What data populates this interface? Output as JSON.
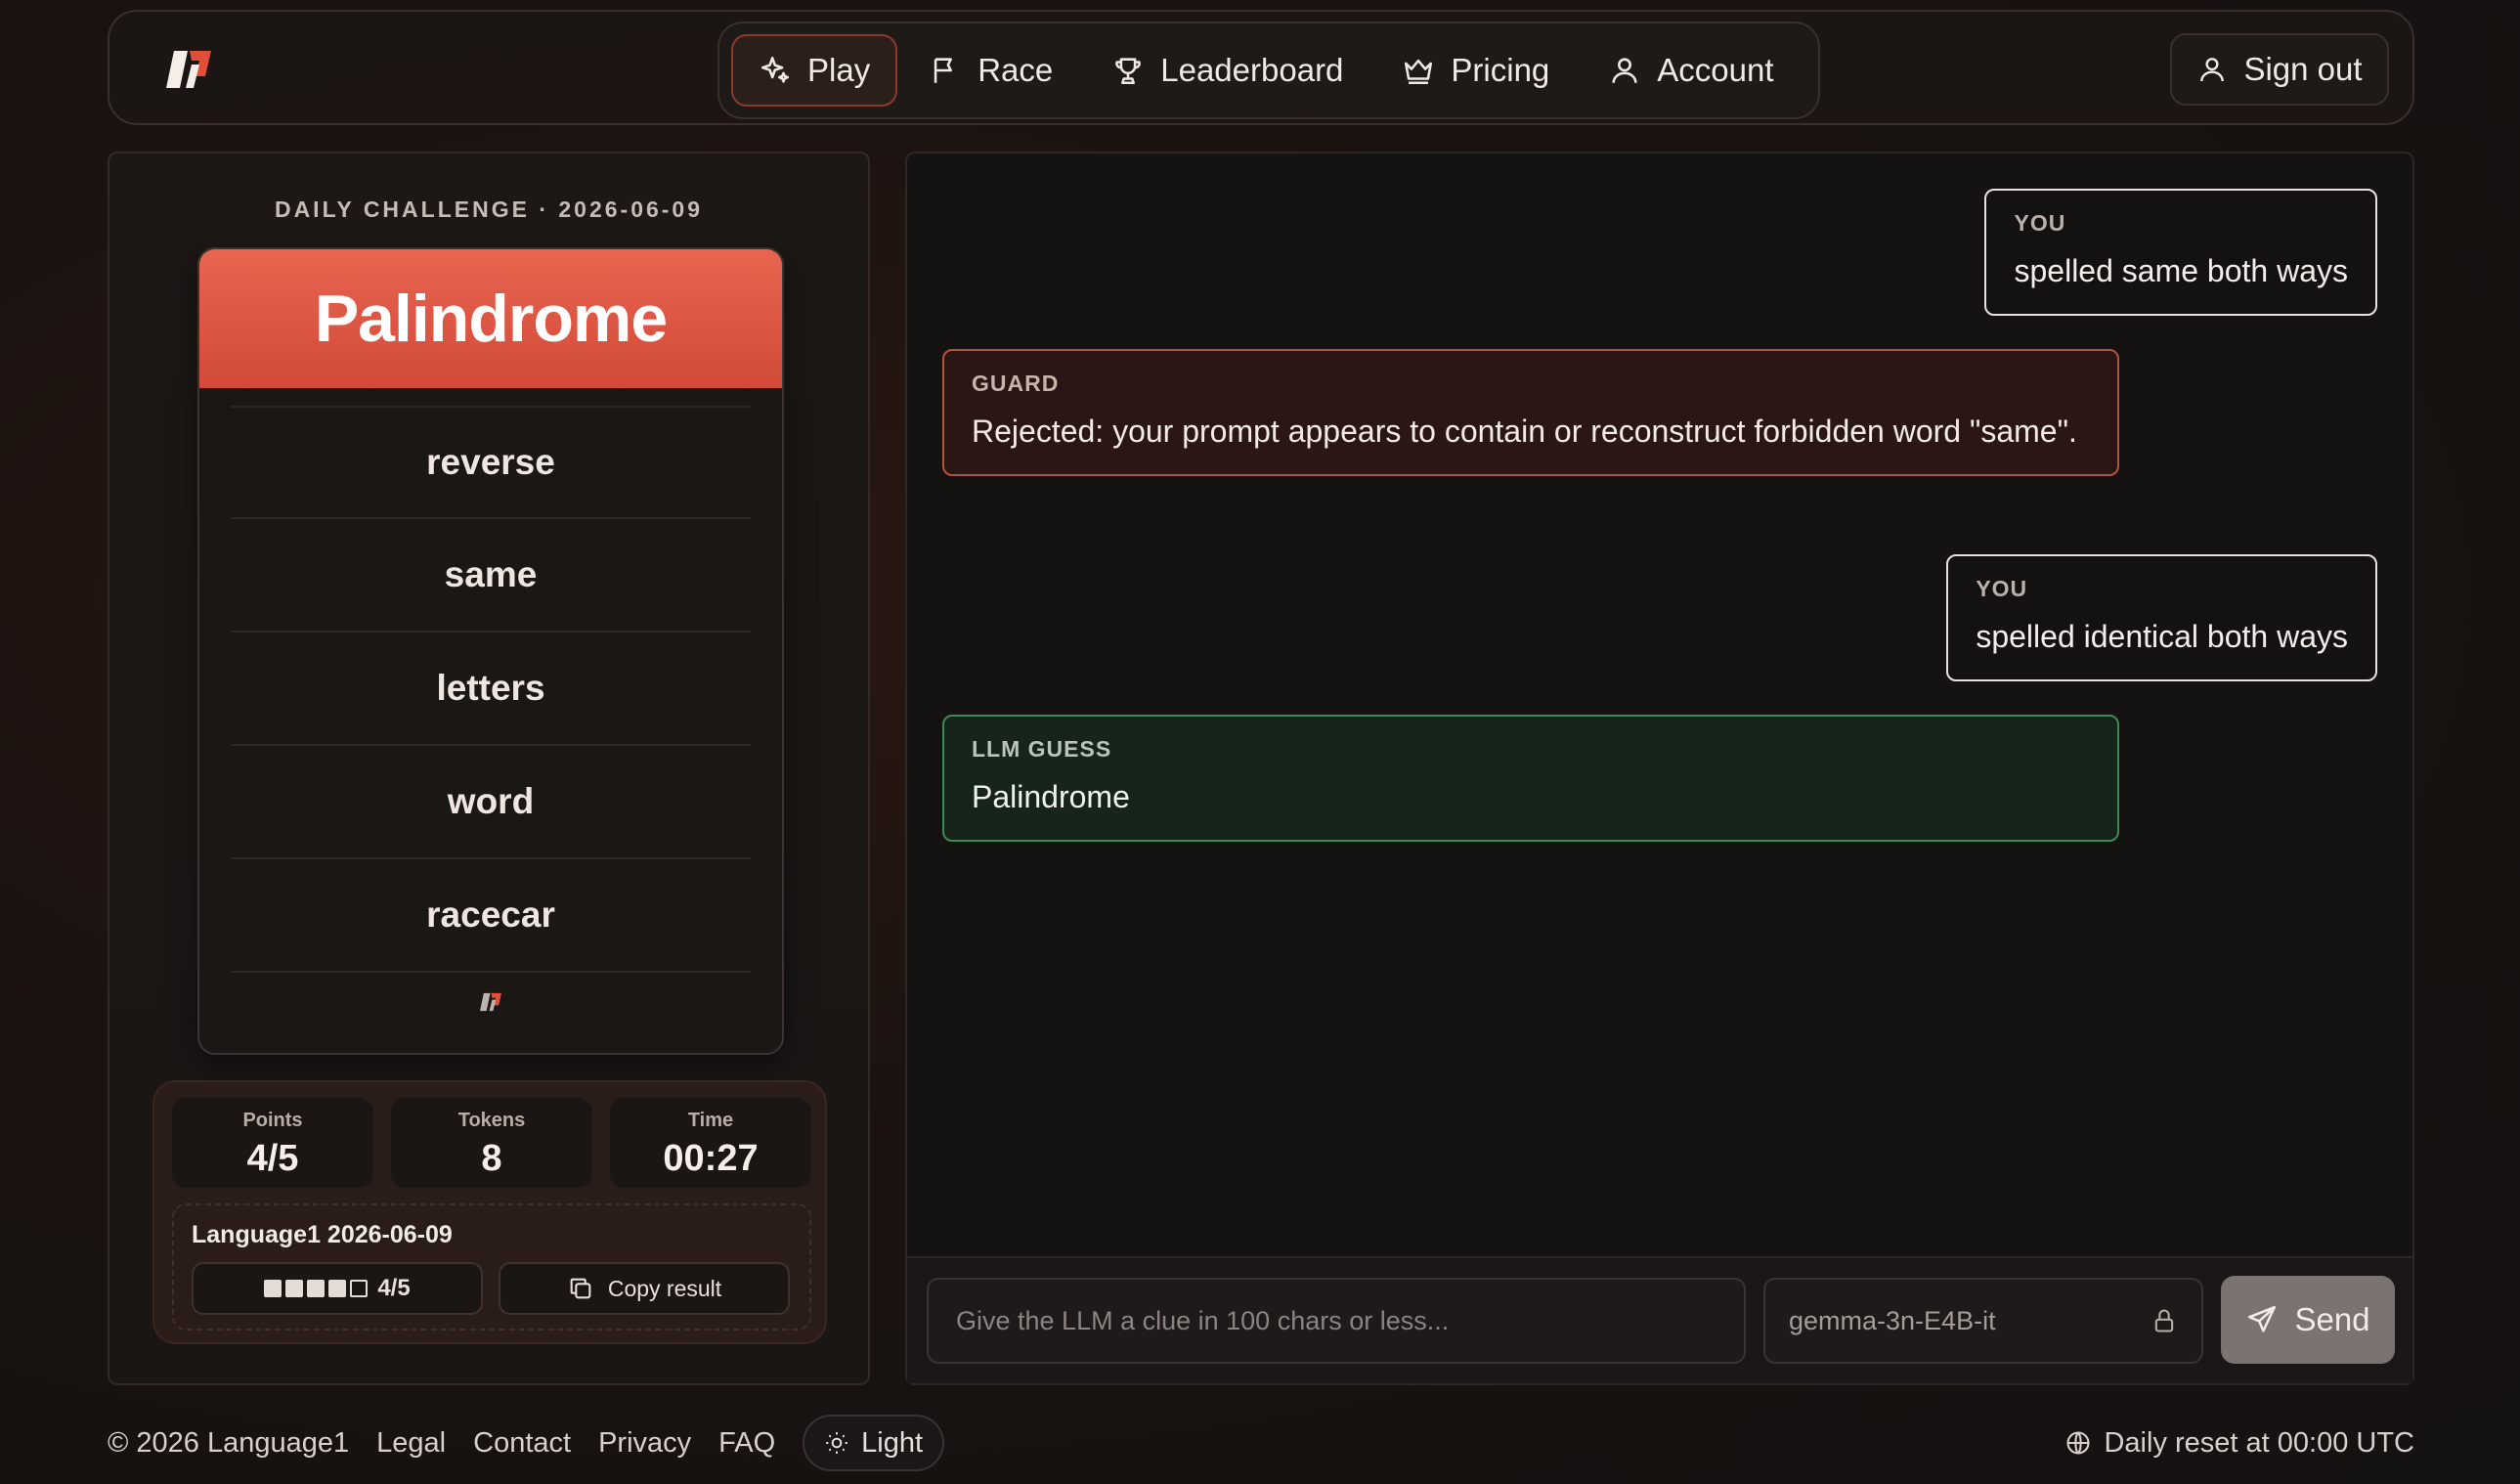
{
  "header": {
    "nav": [
      {
        "label": "Play",
        "icon": "sparkles-icon",
        "active": true
      },
      {
        "label": "Race",
        "icon": "flag-icon"
      },
      {
        "label": "Leaderboard",
        "icon": "trophy-icon"
      },
      {
        "label": "Pricing",
        "icon": "crown-icon"
      },
      {
        "label": "Account",
        "icon": "user-icon"
      }
    ],
    "signout_label": "Sign out"
  },
  "challenge": {
    "title": "DAILY CHALLENGE · 2026-06-09",
    "target_word": "Palindrome",
    "forbidden_words": [
      "reverse",
      "same",
      "letters",
      "word",
      "racecar"
    ]
  },
  "stats": {
    "points_label": "Points",
    "points_value": "4/5",
    "tokens_label": "Tokens",
    "tokens_value": "8",
    "time_label": "Time",
    "time_value": "00:27"
  },
  "result": {
    "title": "Language1 2026-06-09",
    "score": "4/5",
    "filled_squares": 4,
    "total_squares": 5,
    "copy_label": "Copy result"
  },
  "chat": {
    "messages": [
      {
        "role": "YOU",
        "text": "spelled same both ways"
      },
      {
        "role": "GUARD",
        "text": "Rejected: your prompt appears to contain or reconstruct forbidden word \"same\"."
      },
      {
        "role": "YOU",
        "text": "spelled identical both ways"
      },
      {
        "role": "LLM GUESS",
        "text": "Palindrome"
      }
    ],
    "input_placeholder": "Give the LLM a clue in 100 chars or less...",
    "model": "gemma-3n-E4B-it",
    "send_label": "Send"
  },
  "footer": {
    "copyright": "© 2026 Language1",
    "links": [
      "Legal",
      "Contact",
      "Privacy",
      "FAQ"
    ],
    "theme_label": "Light",
    "reset_text": "Daily reset at 00:00 UTC"
  },
  "colors": {
    "accent": "#d9503d",
    "guard_border": "#b5523f",
    "llm_border": "#3d8a52",
    "background": "#151312"
  }
}
